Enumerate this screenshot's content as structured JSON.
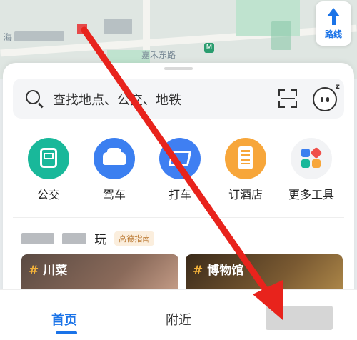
{
  "map": {
    "left_text": "海",
    "street_label": "嘉禾东路",
    "route_button_label": "路线",
    "metro_icon": "metro-station-icon"
  },
  "search": {
    "placeholder": "查找地点、公交、地铁",
    "scan_icon": "scan-icon",
    "assistant_icon": "assistant-bot-icon",
    "assistant_badge": "z"
  },
  "quick_actions": [
    {
      "label": "公交",
      "icon": "bus-icon",
      "color": "#19b89a"
    },
    {
      "label": "驾车",
      "icon": "car-icon",
      "color": "#3b7ff0"
    },
    {
      "label": "打车",
      "icon": "taxi-icon",
      "color": "#3f7ff2"
    },
    {
      "label": "订酒店",
      "icon": "hotel-icon",
      "color": "#f7a63a"
    },
    {
      "label": "更多工具",
      "icon": "more-tools-icon",
      "color": "#f2f3f5"
    }
  ],
  "recommend": {
    "title_suffix": "玩",
    "tag": "高德指南"
  },
  "cards": [
    {
      "hash": "#",
      "label": "川菜"
    },
    {
      "hash": "#",
      "label": "博物馆"
    }
  ],
  "tabbar": {
    "home": "首页",
    "nearby": "附近"
  },
  "colors": {
    "accent": "#1a73e8",
    "annotation_arrow": "#e8231c"
  }
}
